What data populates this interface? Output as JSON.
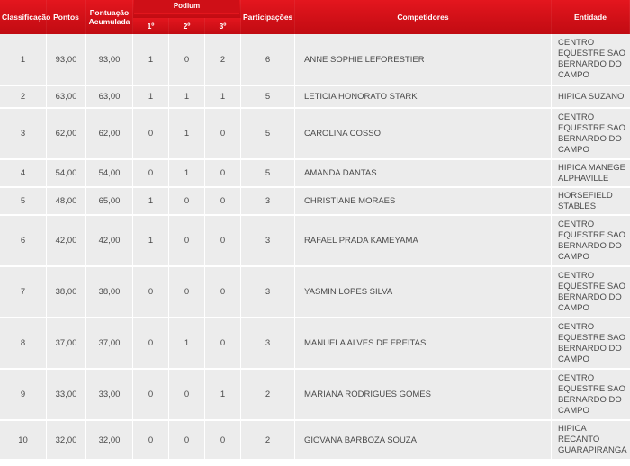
{
  "headers": {
    "classificacao": "Classificação",
    "pontos": "Pontos",
    "pontuacao_acumulada": "Pontuação Acumulada",
    "podium": "Podium",
    "primeiro": "1º",
    "segundo": "2º",
    "terceiro": "3º",
    "participacoes": "Participações",
    "competidores": "Competidores",
    "entidade": "Entidade"
  },
  "rows": [
    {
      "pos": "1",
      "pontos": "93,00",
      "acumulada": "93,00",
      "p1": "1",
      "p2": "0",
      "p3": "2",
      "part": "6",
      "nome": "ANNE SOPHIE LEFORESTIER",
      "entidade": "CENTRO EQUESTRE SAO BERNARDO DO CAMPO"
    },
    {
      "pos": "2",
      "pontos": "63,00",
      "acumulada": "63,00",
      "p1": "1",
      "p2": "1",
      "p3": "1",
      "part": "5",
      "nome": "LETICIA HONORATO STARK",
      "entidade": "HIPICA SUZANO"
    },
    {
      "pos": "3",
      "pontos": "62,00",
      "acumulada": "62,00",
      "p1": "0",
      "p2": "1",
      "p3": "0",
      "part": "5",
      "nome": "CAROLINA COSSO",
      "entidade": "CENTRO EQUESTRE SAO BERNARDO DO CAMPO"
    },
    {
      "pos": "4",
      "pontos": "54,00",
      "acumulada": "54,00",
      "p1": "0",
      "p2": "1",
      "p3": "0",
      "part": "5",
      "nome": "AMANDA DANTAS",
      "entidade": "HIPICA MANEGE ALPHAVILLE"
    },
    {
      "pos": "5",
      "pontos": "48,00",
      "acumulada": "65,00",
      "p1": "1",
      "p2": "0",
      "p3": "0",
      "part": "3",
      "nome": "CHRISTIANE MORAES",
      "entidade": "HORSEFIELD STABLES"
    },
    {
      "pos": "6",
      "pontos": "42,00",
      "acumulada": "42,00",
      "p1": "1",
      "p2": "0",
      "p3": "0",
      "part": "3",
      "nome": "RAFAEL PRADA KAMEYAMA",
      "entidade": "CENTRO EQUESTRE SAO BERNARDO DO CAMPO"
    },
    {
      "pos": "7",
      "pontos": "38,00",
      "acumulada": "38,00",
      "p1": "0",
      "p2": "0",
      "p3": "0",
      "part": "3",
      "nome": "YASMIN LOPES SILVA",
      "entidade": "CENTRO EQUESTRE SAO BERNARDO DO CAMPO"
    },
    {
      "pos": "8",
      "pontos": "37,00",
      "acumulada": "37,00",
      "p1": "0",
      "p2": "1",
      "p3": "0",
      "part": "3",
      "nome": "MANUELA ALVES DE FREITAS",
      "entidade": "CENTRO EQUESTRE SAO BERNARDO DO CAMPO"
    },
    {
      "pos": "9",
      "pontos": "33,00",
      "acumulada": "33,00",
      "p1": "0",
      "p2": "0",
      "p3": "1",
      "part": "2",
      "nome": "MARIANA RODRIGUES GOMES",
      "entidade": "CENTRO EQUESTRE SAO BERNARDO DO CAMPO"
    },
    {
      "pos": "10",
      "pontos": "32,00",
      "acumulada": "32,00",
      "p1": "0",
      "p2": "0",
      "p3": "0",
      "part": "2",
      "nome": "GIOVANA BARBOZA SOUZA",
      "entidade": "HIPICA RECANTO GUARAPIRANGA"
    }
  ],
  "colors": {
    "header_red": "#d5121a",
    "row_background": "#ececec",
    "text": "#4a4a4a"
  }
}
